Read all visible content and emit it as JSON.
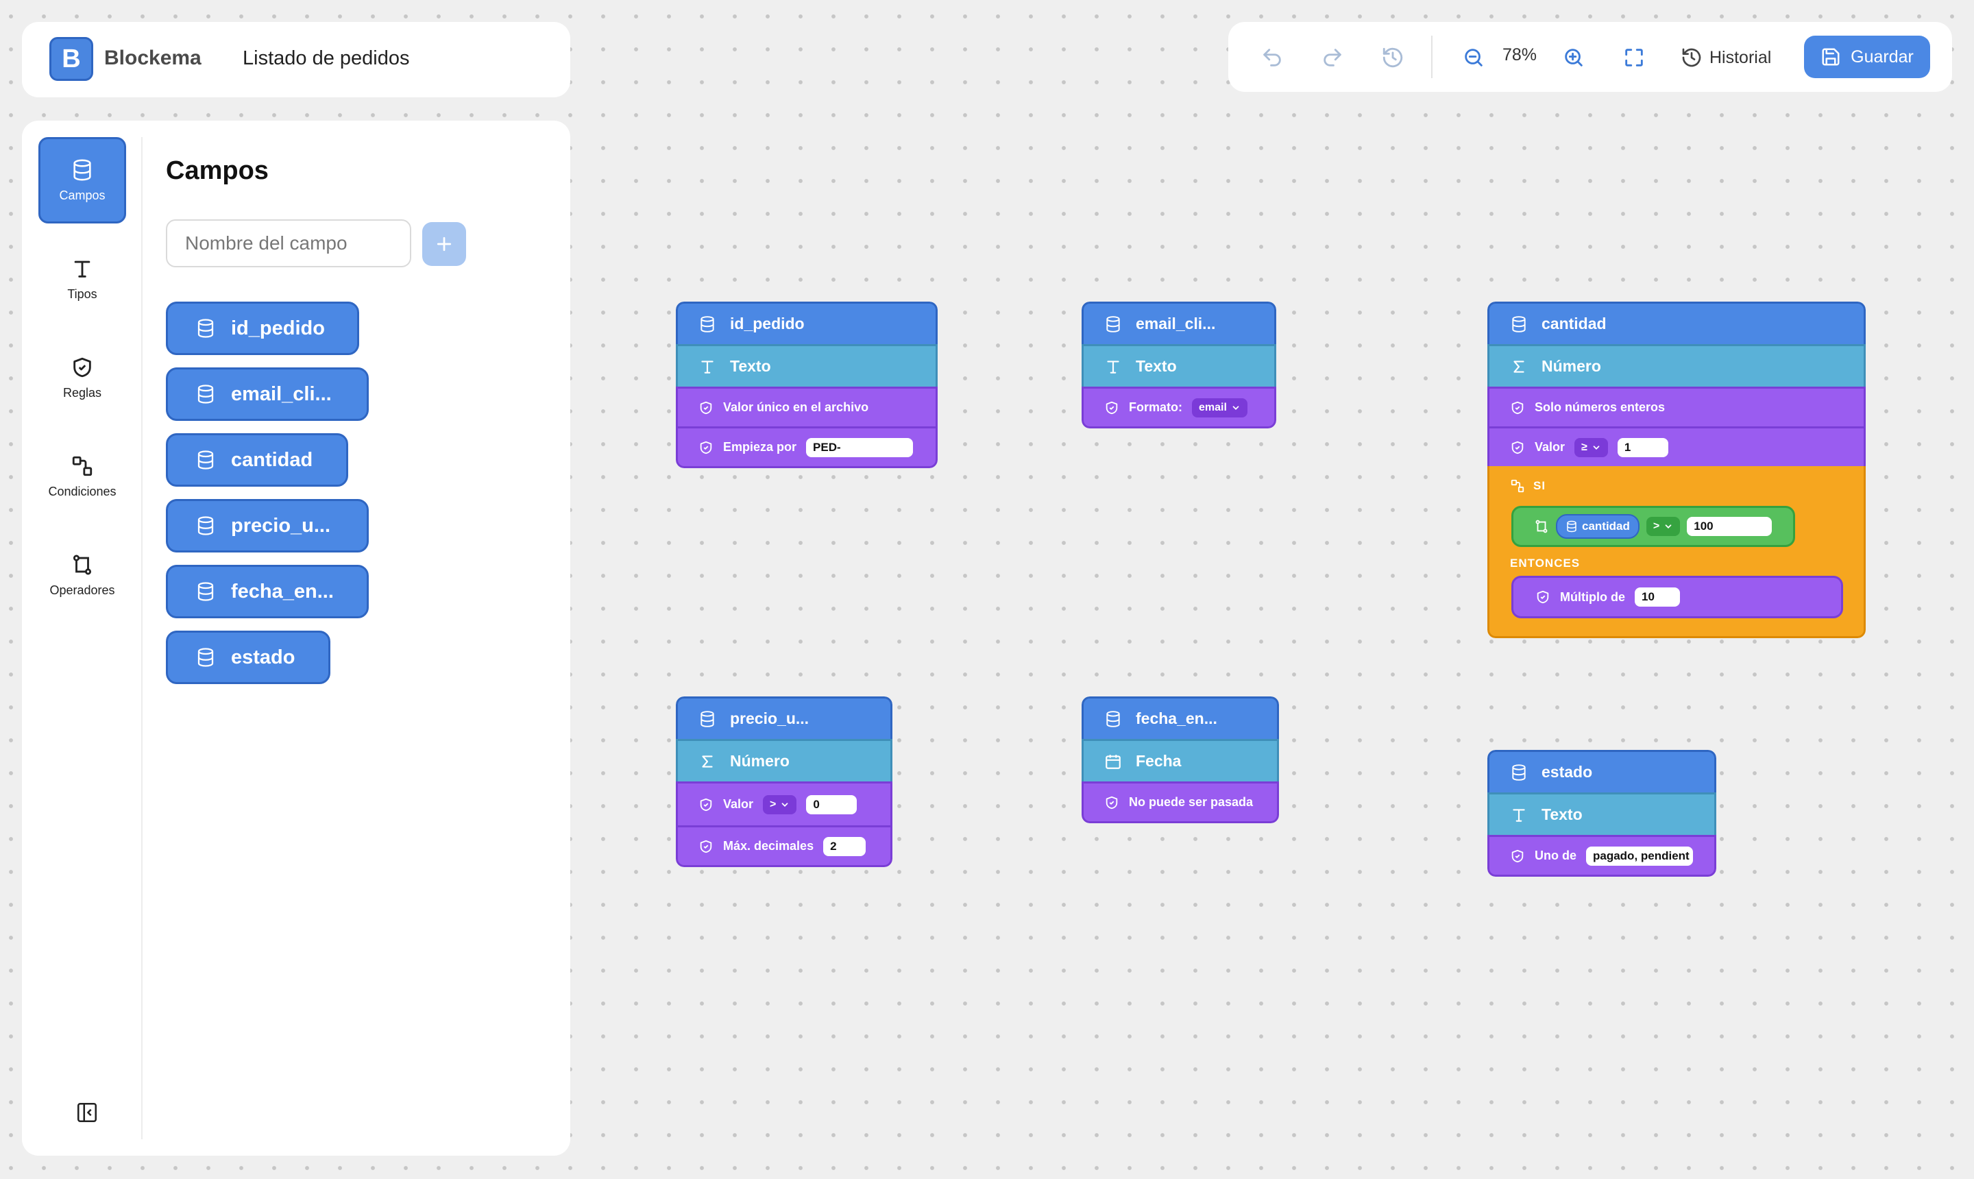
{
  "app": {
    "logo_letter": "B",
    "name": "Blockema",
    "document_title": "Listado de pedidos"
  },
  "toolbar": {
    "zoom_level": "78%",
    "history_label": "Historial",
    "save_label": "Guardar"
  },
  "rail": {
    "items": [
      {
        "label": "Campos",
        "icon": "database-icon",
        "active": true
      },
      {
        "label": "Tipos",
        "icon": "type-icon"
      },
      {
        "label": "Reglas",
        "icon": "shield-check-icon"
      },
      {
        "label": "Condiciones",
        "icon": "condition-icon"
      },
      {
        "label": "Operadores",
        "icon": "operator-icon"
      }
    ]
  },
  "panel": {
    "title": "Campos",
    "input_placeholder": "Nombre del campo",
    "fields": [
      "id_pedido",
      "email_cli...",
      "cantidad",
      "precio_u...",
      "fecha_en...",
      "estado"
    ]
  },
  "blocks": {
    "id_pedido": {
      "name": "id_pedido",
      "type": "Texto",
      "rule1": "Valor único en el archivo",
      "rule2_label": "Empieza por",
      "rule2_value": "PED-"
    },
    "email": {
      "name": "email_cli...",
      "type": "Texto",
      "rule_label": "Formato:",
      "rule_option": "email"
    },
    "cantidad": {
      "name": "cantidad",
      "type": "Número",
      "rule1": "Solo números enteros",
      "rule2_label": "Valor",
      "rule2_op": "≥",
      "rule2_value": "1",
      "if_label": "SI",
      "cond_field": "cantidad",
      "cond_op": ">",
      "cond_value": "100",
      "then_label": "ENTONCES",
      "then_rule_label": "Múltiplo de",
      "then_rule_value": "10"
    },
    "precio": {
      "name": "precio_u...",
      "type": "Número",
      "rule1_label": "Valor",
      "rule1_op": ">",
      "rule1_value": "0",
      "rule2_label": "Máx. decimales",
      "rule2_value": "2"
    },
    "fecha": {
      "name": "fecha_en...",
      "type": "Fecha",
      "rule": "No puede ser pasada"
    },
    "estado": {
      "name": "estado",
      "type": "Texto",
      "rule_label": "Uno de",
      "rule_value": "pagado, pendient"
    }
  },
  "colors": {
    "field": "#4b88e4",
    "type": "#5ab1d8",
    "rule": "#9a5cf0",
    "condition": "#f6a61f",
    "comparison": "#57c05d"
  }
}
